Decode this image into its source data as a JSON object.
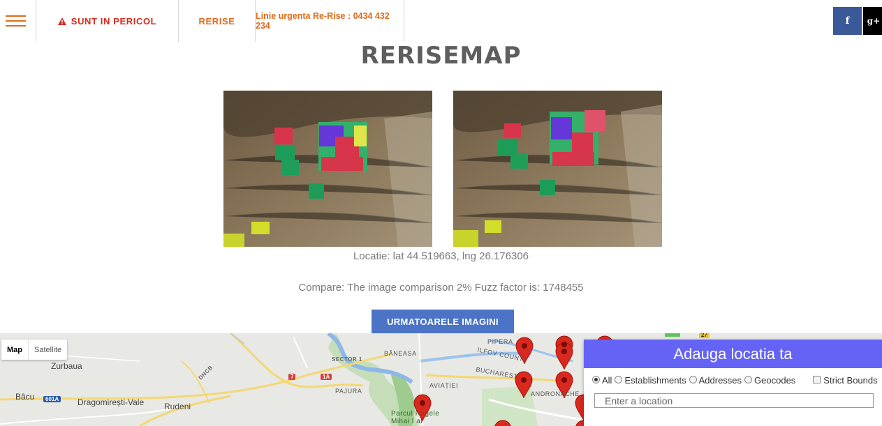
{
  "nav": {
    "danger_label": "SUNT IN PERICOL",
    "rerise_label": "RERISE",
    "phone_label": "Linie urgenta Re-Rise : 0434 432 234",
    "facebook": "f",
    "googleplus": "g+"
  },
  "page": {
    "title": "RERISEMAP",
    "location_text": "Locatie: lat 44.519663, lng 26.176306",
    "compare_text": "Compare: The image comparison 2% Fuzz factor is: 1748455",
    "next_button": "URMATOARELE IMAGINI"
  },
  "map": {
    "type_map": "Map",
    "type_satellite": "Satellite",
    "labels": {
      "zurbaua": "Zurbaua",
      "bacu": "Bâcu",
      "dragomiresti": "Dragomirești-Vale",
      "rudeni": "Rudeni",
      "sector1": "SECTOR 1",
      "baneasa": "BĂNEASA",
      "piperal": "PIPERA",
      "ilfov": "ILFOV COUNTY",
      "bucharest": "BUCHAREST",
      "andronache": "ANDRONACHE",
      "aviatiei": "AVIAȚIEI",
      "pajura": "PAJURA",
      "dncb": "DNCB",
      "park": "Parcul Regele Mihai I al"
    },
    "shields": [
      "7",
      "1A",
      "601A",
      "27"
    ]
  },
  "location_panel": {
    "title": "Adauga locatia ta",
    "filters": [
      "All",
      "Establishments",
      "Addresses",
      "Geocodes"
    ],
    "selected_filter": "All",
    "strict_bounds": "Strict Bounds",
    "input_placeholder": "Enter a location"
  },
  "colors": {
    "accent_orange": "#e06a1b",
    "danger_red": "#d42a1e",
    "button_blue": "#4b73c6",
    "panel_purple": "#6563f6",
    "facebook_blue": "#3b5998"
  }
}
